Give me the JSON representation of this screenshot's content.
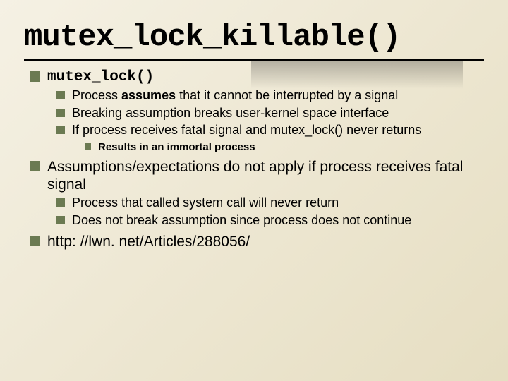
{
  "title": "mutex_lock_killable()",
  "items": [
    {
      "text": "mutex_lock()",
      "mono": true,
      "children": [
        {
          "html": "Process <b>assumes</b> that it cannot be interrupted by a signal"
        },
        {
          "html": "Breaking assumption breaks user-kernel space interface"
        },
        {
          "html": "If process receives fatal signal and mutex_lock() never returns",
          "children": [
            {
              "html": "Results in an <b>immortal process</b>"
            }
          ]
        }
      ]
    },
    {
      "text": "Assumptions/expectations do not apply if process receives fatal signal",
      "children": [
        {
          "html": "Process that called system call will never return"
        },
        {
          "html": "Does not break assumption since process does not continue"
        }
      ]
    },
    {
      "text": "http: //lwn. net/Articles/288056/"
    }
  ]
}
